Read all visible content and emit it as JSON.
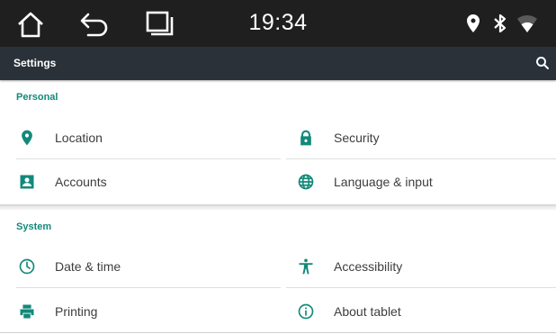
{
  "status_bar": {
    "time": "19:34",
    "nav_icons": [
      "home-icon",
      "back-icon",
      "recents-icon"
    ],
    "status_icons": [
      "location-pin-icon",
      "bluetooth-icon",
      "wifi-icon"
    ]
  },
  "toolbar": {
    "title": "Settings",
    "search_icon": "search-icon"
  },
  "sections": {
    "personal": {
      "header": "Personal",
      "items": [
        {
          "label": "Location",
          "icon": "location-pin-icon"
        },
        {
          "label": "Security",
          "icon": "lock-icon"
        },
        {
          "label": "Accounts",
          "icon": "account-box-icon"
        },
        {
          "label": "Language & input",
          "icon": "globe-icon"
        }
      ]
    },
    "system": {
      "header": "System",
      "items": [
        {
          "label": "Date & time",
          "icon": "clock-icon"
        },
        {
          "label": "Accessibility",
          "icon": "accessibility-icon"
        },
        {
          "label": "Printing",
          "icon": "printer-icon"
        },
        {
          "label": "About tablet",
          "icon": "info-icon"
        }
      ]
    }
  },
  "colors": {
    "accent": "#12897a",
    "status_bar": "#1f1f1f",
    "toolbar": "#2b3139",
    "text": "#3d3d3d"
  }
}
